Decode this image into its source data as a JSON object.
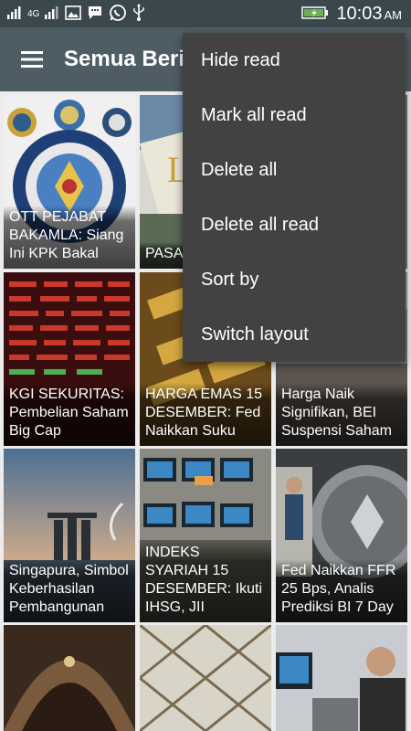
{
  "status_bar": {
    "signal_1": "4G",
    "time": "10:03",
    "ampm": "AM",
    "icons": [
      "signal-icon",
      "signal-4g-icon",
      "image-icon",
      "message-icon",
      "whatsapp-icon",
      "usb-icon",
      "battery-icon"
    ]
  },
  "toolbar": {
    "title": "Semua Beri"
  },
  "menu": {
    "items": [
      "Hide read",
      "Mark all read",
      "Delete all",
      "Delete all read",
      "Sort by",
      "Switch layout"
    ]
  },
  "cards": [
    {
      "caption": "OTT PEJABAT BAKAMLA: Siang Ini KPK Bakal"
    },
    {
      "caption": "PASA Imbas Suku"
    },
    {
      "caption": ""
    },
    {
      "caption": "KGI SEKURITAS: Pembelian Saham Big Cap"
    },
    {
      "caption": "HARGA EMAS 15 DESEMBER: Fed Naikkan Suku"
    },
    {
      "caption": "Harga Naik Signifikan, BEI Suspensi Saham"
    },
    {
      "caption": "Singapura, Simbol Keberhasilan Pembangunan"
    },
    {
      "caption": "INDEKS SYARIAH 15 DESEMBER: Ikuti IHSG, JII"
    },
    {
      "caption": "Fed Naikkan FFR 25 Bps, Analis Prediksi BI 7 Day"
    },
    {
      "caption": ""
    },
    {
      "caption": ""
    },
    {
      "caption": ""
    }
  ]
}
